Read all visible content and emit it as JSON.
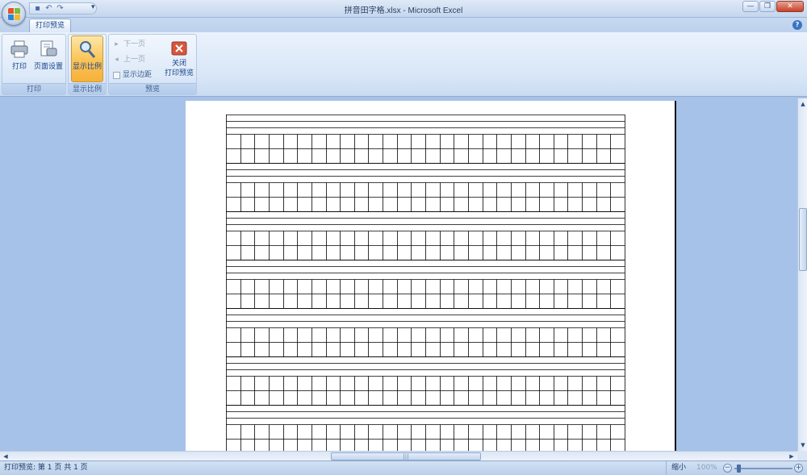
{
  "window": {
    "title": "拼音田字格.xlsx - Microsoft Excel",
    "office_button_icon": "office-logo-icon",
    "quick_access": [
      "save-icon",
      "undo-icon",
      "redo-icon"
    ],
    "quick_access_more": "▾",
    "controls": {
      "minimize": "—",
      "restore": "❐",
      "close": "✕"
    }
  },
  "ribbon": {
    "active_tab": "打印预览",
    "help": "?",
    "groups": {
      "print": {
        "label": "打印",
        "print_button": "打印",
        "page_setup_button": "页面设置"
      },
      "zoom": {
        "label": "显示比例",
        "zoom_button": "显示比例"
      },
      "preview": {
        "label": "预览",
        "next_page": "下一页",
        "prev_page": "上一页",
        "show_margins": "显示边距",
        "close_preview_line1": "关闭",
        "close_preview_line2": "打印预览"
      }
    }
  },
  "statusbar": {
    "text": "打印预览: 第 1 页 共 1 页",
    "zoom_out_label": "缩小",
    "zoom_percent": "100%",
    "zoom_level": 0.05
  },
  "colors": {
    "ribbon_bg": "#d8e6f7",
    "preview_bg": "#a7c2e8",
    "active_button": "#fbc55a",
    "close_red": "#c8412a"
  }
}
